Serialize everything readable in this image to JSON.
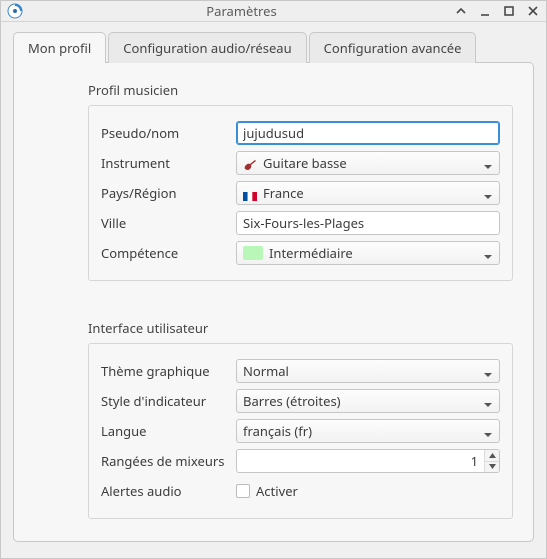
{
  "window": {
    "title": "Paramètres"
  },
  "tabs": [
    {
      "label": "Mon profil",
      "active": true
    },
    {
      "label": "Configuration audio/réseau",
      "active": false
    },
    {
      "label": "Configuration avancée",
      "active": false
    }
  ],
  "profile": {
    "section_title": "Profil musicien",
    "pseudo_label": "Pseudo/nom",
    "pseudo_value": "jujudusud",
    "instrument_label": "Instrument",
    "instrument_value": "Guitare basse",
    "country_label": "Pays/Région",
    "country_value": "France",
    "city_label": "Ville",
    "city_value": "Six-Fours-les-Plages",
    "skill_label": "Compétence",
    "skill_value": "Intermédiaire"
  },
  "ui": {
    "section_title": "Interface utilisateur",
    "theme_label": "Thème graphique",
    "theme_value": "Normal",
    "indicator_label": "Style d'indicateur",
    "indicator_value": "Barres (étroites)",
    "language_label": "Langue",
    "language_value": "français (fr)",
    "mixer_rows_label": "Rangées de mixeurs",
    "mixer_rows_value": "1",
    "audio_alerts_label": "Alertes audio",
    "audio_alerts_checkbox_label": "Activer",
    "audio_alerts_checked": false
  }
}
